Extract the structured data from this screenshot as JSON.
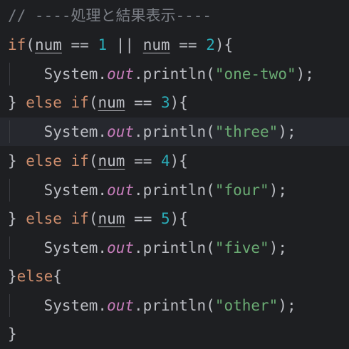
{
  "editor": {
    "comment": "// ----処理と結果表示----",
    "kw_if": "if",
    "kw_else": "else",
    "var_num": "num",
    "system": "System.",
    "out": "out",
    "println": ".println(",
    "eq": " == ",
    "or": " || ",
    "values": [
      "1",
      "2",
      "3",
      "4",
      "5"
    ],
    "strings": [
      "\"one-two\"",
      "\"three\"",
      "\"four\"",
      "\"five\"",
      "\"other\""
    ]
  }
}
